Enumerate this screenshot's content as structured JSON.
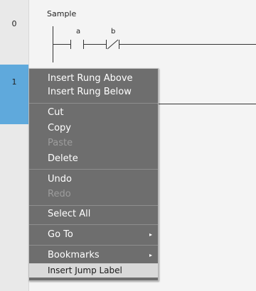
{
  "rungs": [
    {
      "number": "0",
      "title": "Sample",
      "contacts": [
        {
          "label": "a",
          "type": "NO"
        },
        {
          "label": "b",
          "type": "NC"
        }
      ]
    },
    {
      "number": "1"
    }
  ],
  "context_menu": {
    "items": {
      "insert_rung_above": "Insert Rung Above",
      "insert_rung_below": "Insert Rung Below",
      "cut": "Cut",
      "copy": "Copy",
      "paste": "Paste",
      "delete": "Delete",
      "undo": "Undo",
      "redo": "Redo",
      "select_all": "Select All",
      "go_to": "Go To",
      "bookmarks": "Bookmarks",
      "insert_jump_label": "Insert Jump Label"
    },
    "disabled": [
      "paste",
      "redo"
    ],
    "highlighted": "insert_jump_label",
    "submenu_arrow": "▸"
  },
  "colors": {
    "menu_bg": "#6e6e6e",
    "highlight_bg": "#d9d9d9",
    "selected_rung": "#5fa9dc",
    "disabled_text": "#9d9d9d"
  }
}
